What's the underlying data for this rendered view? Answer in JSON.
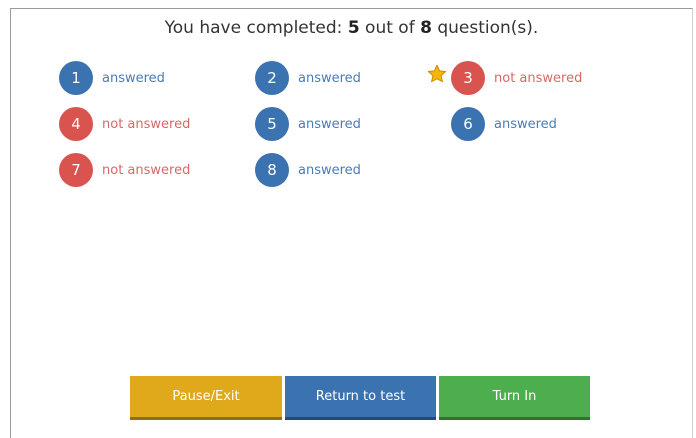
{
  "summary": {
    "prefix": "You have completed: ",
    "completed": "5",
    "middle": " out of ",
    "total": "8",
    "suffix": " question(s)."
  },
  "questions": [
    {
      "number": "1",
      "status": "answered",
      "flagged": false
    },
    {
      "number": "2",
      "status": "answered",
      "flagged": false
    },
    {
      "number": "3",
      "status": "not answered",
      "flagged": true
    },
    {
      "number": "4",
      "status": "not answered",
      "flagged": false
    },
    {
      "number": "5",
      "status": "answered",
      "flagged": false
    },
    {
      "number": "6",
      "status": "answered",
      "flagged": false
    },
    {
      "number": "7",
      "status": "not answered",
      "flagged": false
    },
    {
      "number": "8",
      "status": "answered",
      "flagged": false
    }
  ],
  "icons": {
    "flag": "star-icon"
  },
  "buttons": {
    "pause_exit": "Pause/Exit",
    "return_to_test": "Return to test",
    "turn_in": "Turn In"
  },
  "colors": {
    "answered": "#3b72b0",
    "not_answered": "#d9534f",
    "pause_exit": "#e0a91b",
    "return_to_test": "#3b72b0",
    "turn_in": "#4cae4c",
    "star": "#f5b70a"
  }
}
